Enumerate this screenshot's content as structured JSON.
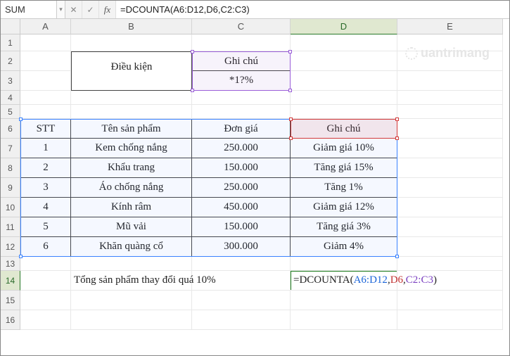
{
  "formula_bar": {
    "name_box": "SUM",
    "cancel": "✕",
    "confirm": "✓",
    "fx": "fx",
    "formula_prefix": "=DCOUNTA(",
    "formula_arg1": "A6:D12",
    "formula_arg2": "D6",
    "formula_arg3": "C2:C3",
    "formula_suffix": ")"
  },
  "columns": [
    "A",
    "B",
    "C",
    "D",
    "E"
  ],
  "rows": [
    "1",
    "2",
    "3",
    "4",
    "5",
    "6",
    "7",
    "8",
    "9",
    "10",
    "11",
    "12",
    "13",
    "14",
    "15",
    "16"
  ],
  "criteria": {
    "label": "Điều kiện",
    "col_header": "Ghi chú",
    "pattern": "*1?%"
  },
  "table": {
    "headers": {
      "stt": "STT",
      "ten": "Tên sản phẩm",
      "dongia": "Đơn giá",
      "ghichu": "Ghi chú"
    },
    "rows": [
      {
        "stt": "1",
        "ten": "Kem chống nắng",
        "dongia": "250.000",
        "ghichu": "Giảm giá 10%"
      },
      {
        "stt": "2",
        "ten": "Khẩu trang",
        "dongia": "150.000",
        "ghichu": "Tăng giá 15%"
      },
      {
        "stt": "3",
        "ten": "Áo chống nắng",
        "dongia": "250.000",
        "ghichu": "Tăng 1%"
      },
      {
        "stt": "4",
        "ten": "Kính râm",
        "dongia": "450.000",
        "ghichu": "Giảm giá 12%"
      },
      {
        "stt": "5",
        "ten": "Mũ vải",
        "dongia": "150.000",
        "ghichu": "Tăng giá 3%"
      },
      {
        "stt": "6",
        "ten": "Khăn quàng cổ",
        "dongia": "300.000",
        "ghichu": "Giảm 4%"
      }
    ]
  },
  "summary_label": "Tổng sản phẩm thay đổi quá 10%",
  "watermark": "uantrimang"
}
